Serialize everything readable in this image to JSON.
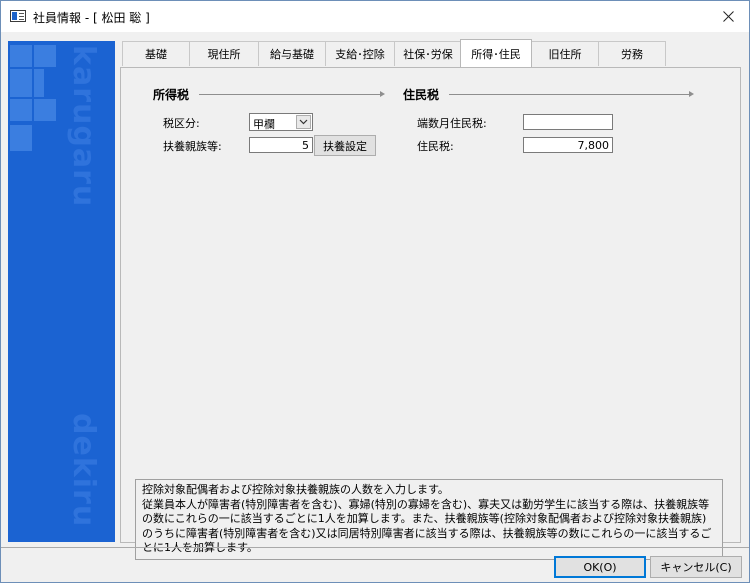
{
  "window": {
    "title": "社員情報 - [ 松田 聡 ]"
  },
  "sidebar": {
    "brand_top": "karugaru",
    "brand_bottom": "dekiru"
  },
  "tabs": [
    {
      "label": "基礎",
      "active": false
    },
    {
      "label": "現住所",
      "active": false
    },
    {
      "label": "給与基礎",
      "active": false
    },
    {
      "label": "支給･控除",
      "active": false
    },
    {
      "label": "社保･労保",
      "active": false
    },
    {
      "label": "所得･住民",
      "active": true
    },
    {
      "label": "旧住所",
      "active": false
    },
    {
      "label": "労務",
      "active": false
    }
  ],
  "income_tax": {
    "section_title": "所得税",
    "tax_class_label": "税区分:",
    "tax_class_value": "甲欄",
    "dependents_label": "扶養親族等:",
    "dependents_value": "5",
    "dependents_button": "扶養設定"
  },
  "resident_tax": {
    "section_title": "住民税",
    "fraction_label": "端数月住民税:",
    "fraction_value": "",
    "tax_label": "住民税:",
    "tax_value": "7,800"
  },
  "help": {
    "lines": [
      "控除対象配偶者および控除対象扶養親族の人数を入力します。",
      "従業員本人が障害者(特別障害者を含む)、寡婦(特別の寡婦を含む)、寡夫又は勤労学生に該当する際は、扶養親族等の数にこれらの一に該当するごとに1人を加算します。また、扶養親族等(控除対象配偶者および控除対象扶養親族)のうちに障害者(特別障害者を含む)又は同居特別障害者に該当する際は、扶養親族等の数にこれらの一に該当するごとに1人を加算します。"
    ]
  },
  "footer": {
    "ok_label": "OK(O)",
    "cancel_label": "キャンセル(C)"
  },
  "colors": {
    "sidebar": "#1b63d2",
    "accent": "#0078d7"
  }
}
